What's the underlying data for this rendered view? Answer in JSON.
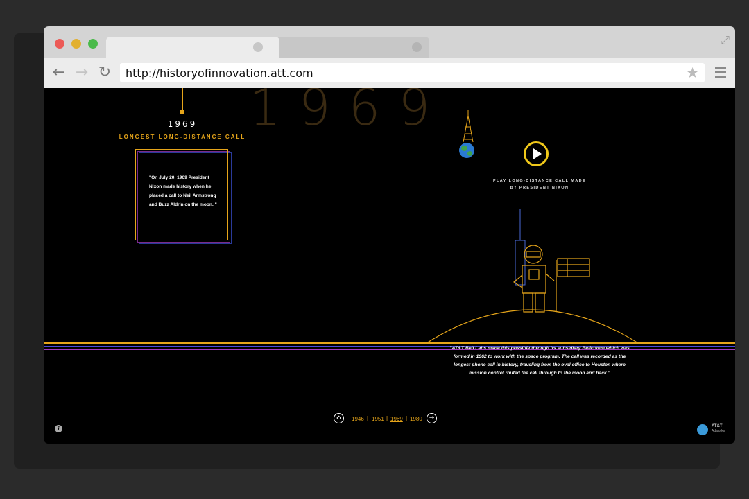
{
  "browser": {
    "url": "http://historyofinnovation.att.com",
    "colors": {
      "close": "#ec5a56",
      "minimize": "#e2b02f",
      "maximize": "#4aba4a"
    },
    "icons": [
      "back-icon",
      "forward-icon",
      "reload-icon",
      "star-icon",
      "menu-icon",
      "expand-icon"
    ]
  },
  "page": {
    "big_year": "1969",
    "timeline": {
      "year": "1969",
      "event_title": "LONGEST LONG-DISTANCE CALL"
    },
    "quote": {
      "text": "\"On July 20, 1969 President Nixon made history when he placed a call to Neil Armstrong and Buzz Aldrin on the moon. \""
    },
    "play": {
      "caption_line1": "PLAY LONG-DISTANCE CALL MADE",
      "caption_line2": "BY PRESIDENT NIXON"
    },
    "description": "\"AT&T Bell Labs made this possible through its subsidiary Bellcomm which was formed in 1962 to work with the space program. The call was recorded as the longest phone call in history, traveling from the oval office to Houston where mission control routed the call through to the moon and back.\"",
    "pager": {
      "years": [
        "1946",
        "1951",
        "1969",
        "1980"
      ],
      "current": "1969"
    },
    "logo": {
      "line1": "AT&T",
      "line2": "Adworks"
    },
    "accent_color": "#e6a51a"
  }
}
